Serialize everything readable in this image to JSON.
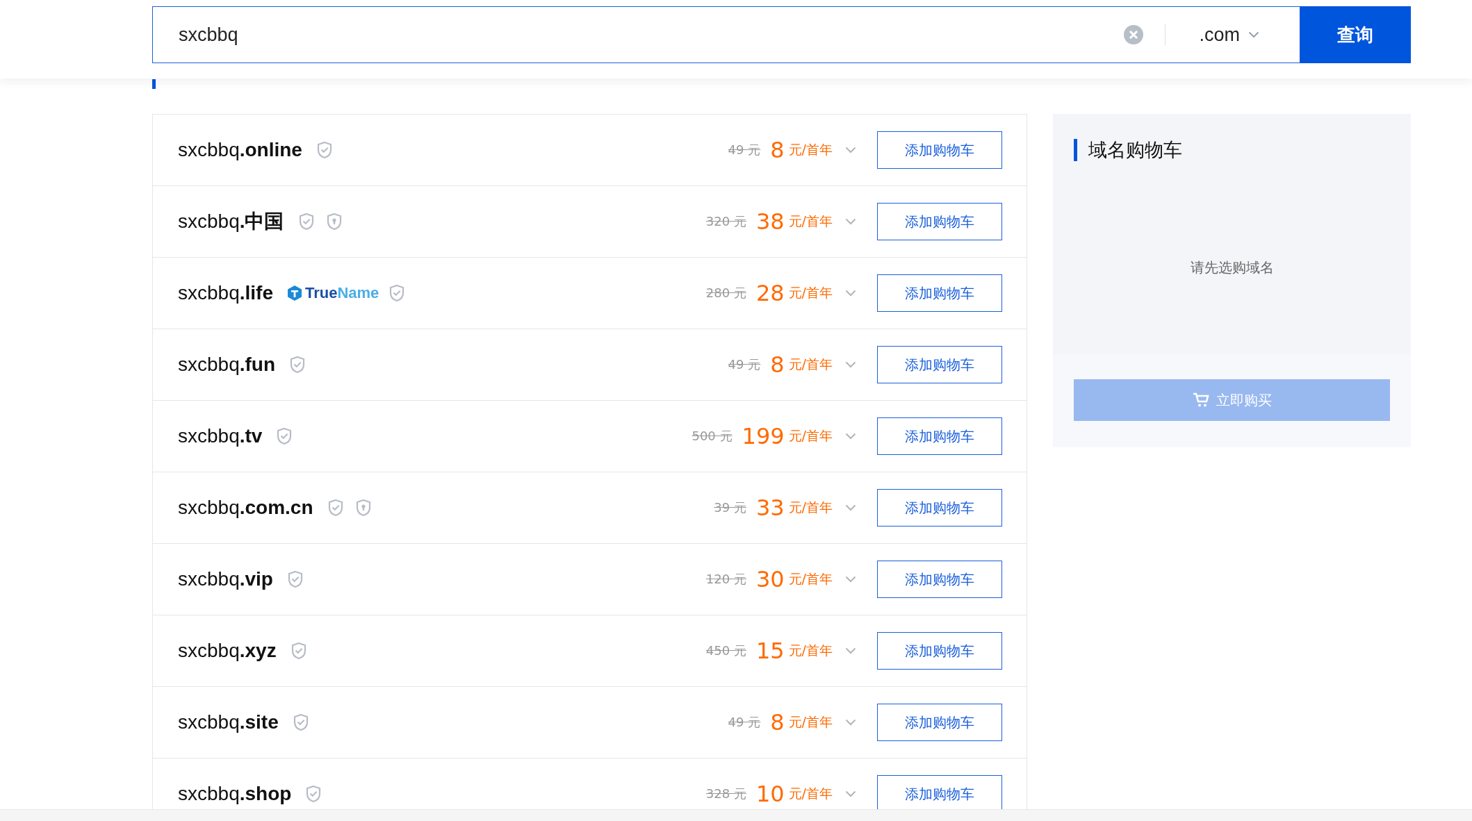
{
  "search": {
    "value": "sxcbbq",
    "suffix": ".com",
    "button": "查询"
  },
  "domains": [
    {
      "name": "sxcbbq",
      "suffix": ".online",
      "badges": [
        {
          "kind": "check"
        }
      ],
      "original_price": "49 元",
      "price": "8",
      "unit": "元/首年",
      "button": "添加购物车"
    },
    {
      "name": "sxcbbq",
      "suffix": ".中国",
      "badges": [
        {
          "kind": "check"
        },
        {
          "kind": "lock"
        }
      ],
      "original_price": "320 元",
      "price": "38",
      "unit": "元/首年",
      "button": "添加购物车"
    },
    {
      "name": "sxcbbq",
      "suffix": ".life",
      "badges": [
        {
          "kind": "truename",
          "parts": [
            "True",
            "Name"
          ]
        },
        {
          "kind": "check"
        }
      ],
      "original_price": "280 元",
      "price": "28",
      "unit": "元/首年",
      "button": "添加购物车"
    },
    {
      "name": "sxcbbq",
      "suffix": ".fun",
      "badges": [
        {
          "kind": "check"
        }
      ],
      "original_price": "49 元",
      "price": "8",
      "unit": "元/首年",
      "button": "添加购物车"
    },
    {
      "name": "sxcbbq",
      "suffix": ".tv",
      "badges": [
        {
          "kind": "check"
        }
      ],
      "original_price": "500 元",
      "price": "199",
      "unit": "元/首年",
      "button": "添加购物车"
    },
    {
      "name": "sxcbbq",
      "suffix": ".com.cn",
      "badges": [
        {
          "kind": "check"
        },
        {
          "kind": "lock"
        }
      ],
      "original_price": "39 元",
      "price": "33",
      "unit": "元/首年",
      "button": "添加购物车"
    },
    {
      "name": "sxcbbq",
      "suffix": ".vip",
      "badges": [
        {
          "kind": "check"
        }
      ],
      "original_price": "120 元",
      "price": "30",
      "unit": "元/首年",
      "button": "添加购物车"
    },
    {
      "name": "sxcbbq",
      "suffix": ".xyz",
      "badges": [
        {
          "kind": "check"
        }
      ],
      "original_price": "450 元",
      "price": "15",
      "unit": "元/首年",
      "button": "添加购物车"
    },
    {
      "name": "sxcbbq",
      "suffix": ".site",
      "badges": [
        {
          "kind": "check"
        }
      ],
      "original_price": "49 元",
      "price": "8",
      "unit": "元/首年",
      "button": "添加购物车"
    },
    {
      "name": "sxcbbq",
      "suffix": ".shop",
      "badges": [
        {
          "kind": "check"
        }
      ],
      "original_price": "328 元",
      "price": "10",
      "unit": "元/首年",
      "button": "添加购物车"
    }
  ],
  "cart": {
    "title": "域名购物车",
    "empty_text": "请先选购域名",
    "buy_button": {
      "label": "立即购买",
      "disabled": true
    }
  }
}
